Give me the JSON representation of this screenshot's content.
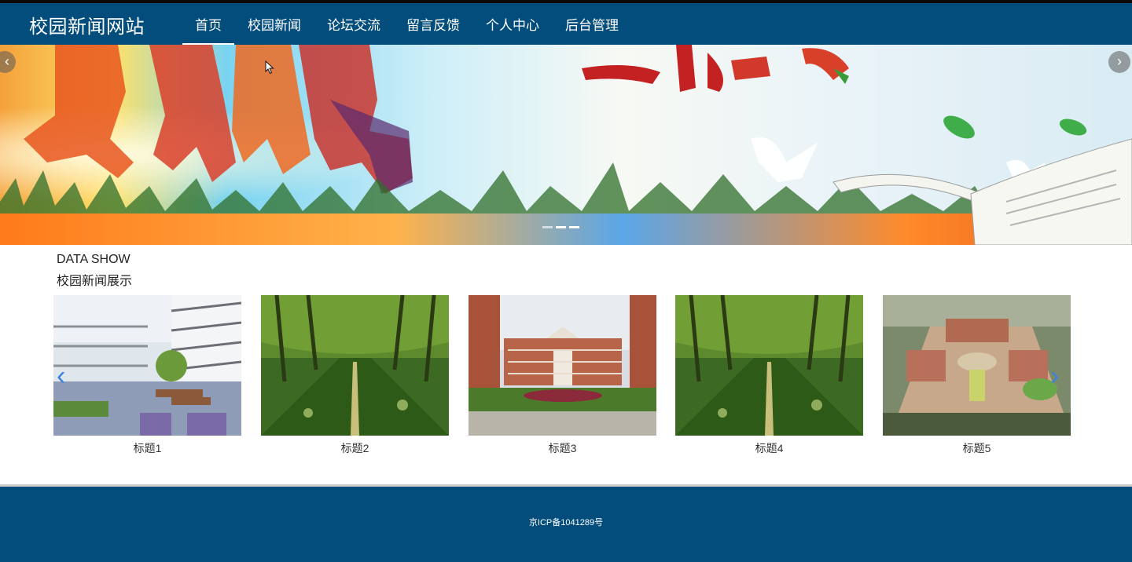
{
  "header": {
    "site_title": "校园新闻网站",
    "nav": [
      {
        "label": "首页",
        "active": true
      },
      {
        "label": "校园新闻"
      },
      {
        "label": "论坛交流"
      },
      {
        "label": "留言反馈"
      },
      {
        "label": "个人中心"
      },
      {
        "label": "后台管理"
      }
    ]
  },
  "banner": {
    "prev_icon": "chevron-left-icon",
    "next_icon": "chevron-right-icon",
    "slide_count": 3,
    "active_slide": 2
  },
  "section": {
    "title_en": "DATA SHOW",
    "title_zh": "校园新闻展示"
  },
  "gallery": {
    "items": [
      {
        "label": "标题1"
      },
      {
        "label": "标题2"
      },
      {
        "label": "标题3"
      },
      {
        "label": "标题4"
      },
      {
        "label": "标题5"
      }
    ],
    "prev_icon": "chevron-left-icon",
    "next_icon": "chevron-right-icon"
  },
  "footer": {
    "icp": "京ICP备1041289号"
  },
  "colors": {
    "primary": "#034d7d",
    "accent": "#3a82e0"
  }
}
